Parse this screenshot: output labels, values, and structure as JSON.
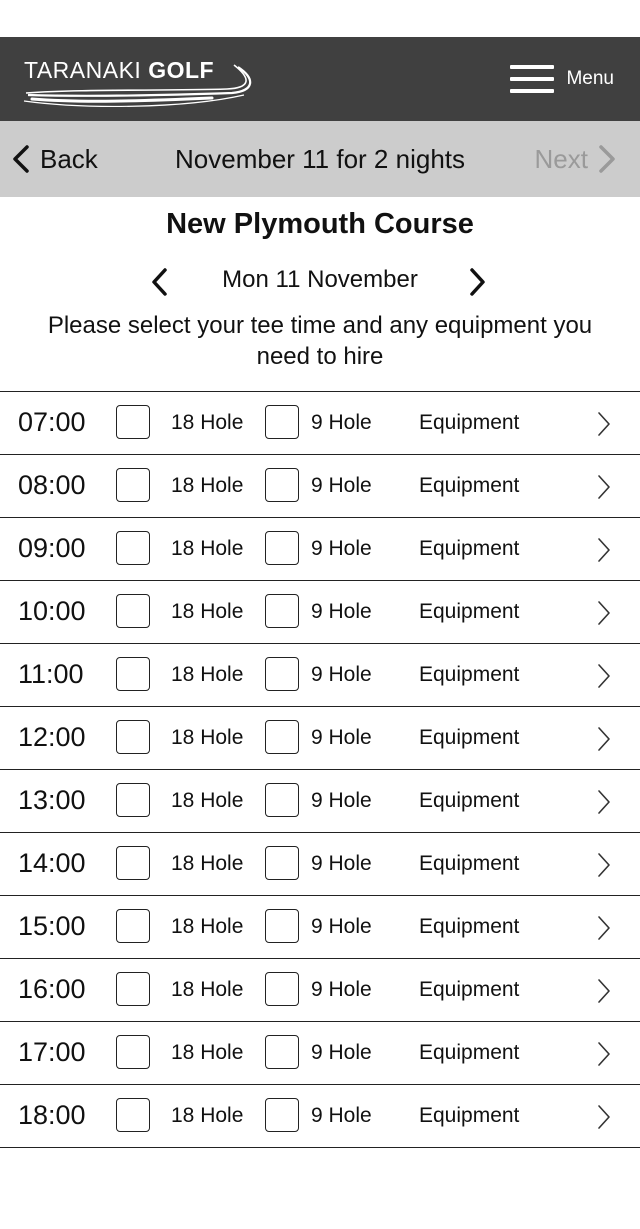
{
  "header": {
    "logo_light": "TARANAKI ",
    "logo_bold": "GOLF",
    "menu_label": "Menu"
  },
  "nav": {
    "back_label": "Back",
    "title": "November 11 for 2 nights",
    "next_label": "Next"
  },
  "course": {
    "title": "New Plymouth Course",
    "date_label": "Mon 11 November",
    "instructions": "Please select your tee time and any equipment you need to hire"
  },
  "slots": [
    {
      "time": "07:00",
      "option_18": "18 Hole",
      "option_9": "9 Hole",
      "equipment": "Equipment"
    },
    {
      "time": "08:00",
      "option_18": "18 Hole",
      "option_9": "9 Hole",
      "equipment": "Equipment"
    },
    {
      "time": "09:00",
      "option_18": "18 Hole",
      "option_9": "9 Hole",
      "equipment": "Equipment"
    },
    {
      "time": "10:00",
      "option_18": "18 Hole",
      "option_9": "9 Hole",
      "equipment": "Equipment"
    },
    {
      "time": "11:00",
      "option_18": "18 Hole",
      "option_9": "9 Hole",
      "equipment": "Equipment"
    },
    {
      "time": "12:00",
      "option_18": "18 Hole",
      "option_9": "9 Hole",
      "equipment": "Equipment"
    },
    {
      "time": "13:00",
      "option_18": "18 Hole",
      "option_9": "9 Hole",
      "equipment": "Equipment"
    },
    {
      "time": "14:00",
      "option_18": "18 Hole",
      "option_9": "9 Hole",
      "equipment": "Equipment"
    },
    {
      "time": "15:00",
      "option_18": "18 Hole",
      "option_9": "9 Hole",
      "equipment": "Equipment"
    },
    {
      "time": "16:00",
      "option_18": "18 Hole",
      "option_9": "9 Hole",
      "equipment": "Equipment"
    },
    {
      "time": "17:00",
      "option_18": "18 Hole",
      "option_9": "9 Hole",
      "equipment": "Equipment"
    },
    {
      "time": "18:00",
      "option_18": "18 Hole",
      "option_9": "9 Hole",
      "equipment": "Equipment"
    }
  ],
  "icons": {
    "menu": "hamburger-icon",
    "back": "chevron-left-icon",
    "next": "chevron-right-icon",
    "date_prev": "chevron-left-icon",
    "date_next": "chevron-right-icon",
    "slot_chevron": "chevron-right-icon"
  },
  "colors": {
    "header_bg": "#404040",
    "nav_bg": "#cccccc",
    "disabled_text": "#9a9a9a"
  }
}
